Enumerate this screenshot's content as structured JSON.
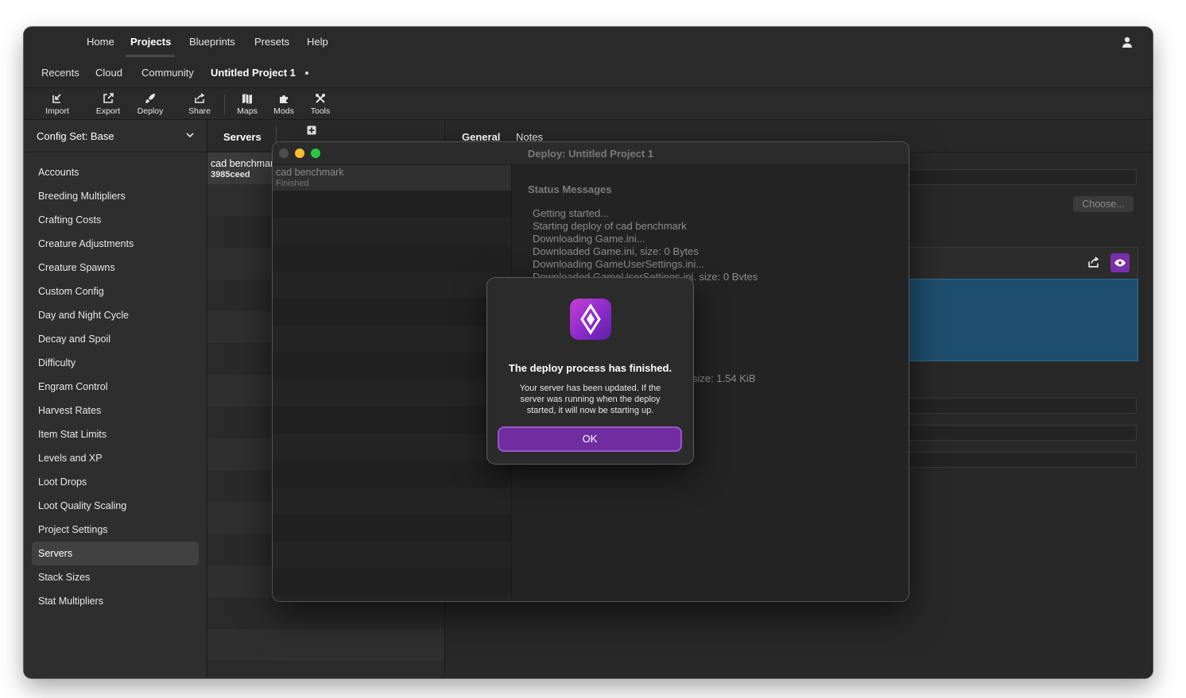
{
  "menubar": {
    "items": [
      "Home",
      "Projects",
      "Blueprints",
      "Presets",
      "Help"
    ],
    "active": "Projects"
  },
  "tabs": {
    "items": [
      "Recents",
      "Cloud",
      "Community",
      "Untitled Project 1"
    ],
    "active": "Untitled Project 1"
  },
  "toolbar": {
    "import": "Import",
    "export": "Export",
    "deploy": "Deploy",
    "share": "Share",
    "maps": "Maps",
    "mods": "Mods",
    "tools": "Tools"
  },
  "sidebar": {
    "config_set": "Config Set: Base",
    "items": [
      "Accounts",
      "Breeding Multipliers",
      "Crafting Costs",
      "Creature Adjustments",
      "Creature Spawns",
      "Custom Config",
      "Day and Night Cycle",
      "Decay and Spoil",
      "Difficulty",
      "Engram Control",
      "Harvest Rates",
      "Item Stat Limits",
      "Levels and XP",
      "Loot Drops",
      "Loot Quality Scaling",
      "Project Settings",
      "Servers",
      "Stack Sizes",
      "Stat Multipliers"
    ],
    "selected": "Servers"
  },
  "servers": {
    "title": "Servers",
    "row": {
      "name": "cad benchmark",
      "id": "3985ceed"
    }
  },
  "right": {
    "tab_general": "General",
    "tab_notes": "Notes",
    "choose": "Choose..."
  },
  "deploy": {
    "title": "Deploy: Untitled Project 1",
    "list_item": {
      "name": "cad benchmark",
      "status": "Finished"
    },
    "status_heading": "Status Messages",
    "messages": [
      "Getting started...",
      "Starting deploy of cad benchmark",
      "Downloading Game.ini...",
      "Downloaded Game.ini, size: 0 Bytes",
      "Downloading GameUserSettings.ini...",
      "Downloaded GameUserSettings.ini, size: 0 Bytes"
    ],
    "tail_message": "size: 1.54 KiB"
  },
  "alert": {
    "title": "The deploy process has finished.",
    "body": "Your server has been updated. If the server was running when the deploy started, it will now be starting up.",
    "ok": "OK"
  },
  "colors": {
    "accent": "#7a2ea8",
    "selection_blue": "#1f4f6e",
    "close": "#ff5f57",
    "minimize": "#febc2e",
    "zoom": "#28c840"
  }
}
